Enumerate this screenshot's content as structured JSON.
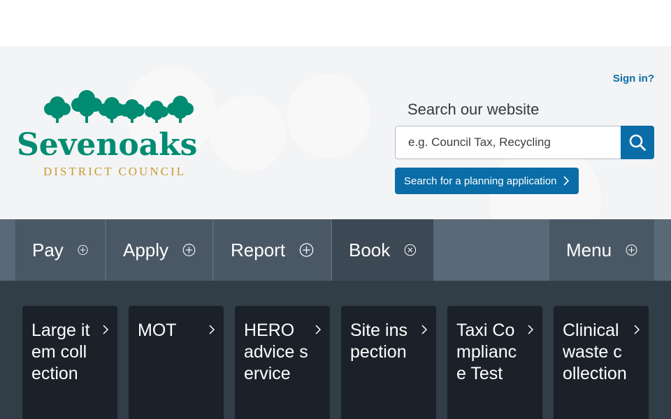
{
  "colors": {
    "brand_green": "#008c72",
    "gold": "#c89a2e",
    "accent_blue": "#0a6da7",
    "nav_bg": "#4a5866",
    "dropdown_bg": "#313d47",
    "card_bg": "#1b2129"
  },
  "header": {
    "logo": {
      "name": "Sevenoaks",
      "subtitle": "DISTRICT COUNCIL",
      "icon": "oak-trees-icon"
    },
    "sign_in": "Sign in?",
    "search": {
      "label": "Search our website",
      "placeholder": "e.g. Council Tax, Recycling",
      "button_icon": "search-icon"
    },
    "planning_button": "Search for a planning application"
  },
  "nav": {
    "items": [
      {
        "label": "Pay",
        "icon": "plus-circle-icon",
        "expanded": false
      },
      {
        "label": "Apply",
        "icon": "plus-circle-icon",
        "expanded": false
      },
      {
        "label": "Report",
        "icon": "plus-circle-icon",
        "expanded": false
      },
      {
        "label": "Book",
        "icon": "close-circle-icon",
        "expanded": true
      }
    ],
    "menu": {
      "label": "Menu",
      "icon": "plus-circle-icon"
    }
  },
  "book_panel": {
    "cards": [
      {
        "label": "Large item collection"
      },
      {
        "label": "MOT"
      },
      {
        "label": "HERO advice service"
      },
      {
        "label": "Site inspection"
      },
      {
        "label": "Taxi Compliance Test"
      },
      {
        "label": "Clinical waste collection"
      }
    ]
  }
}
